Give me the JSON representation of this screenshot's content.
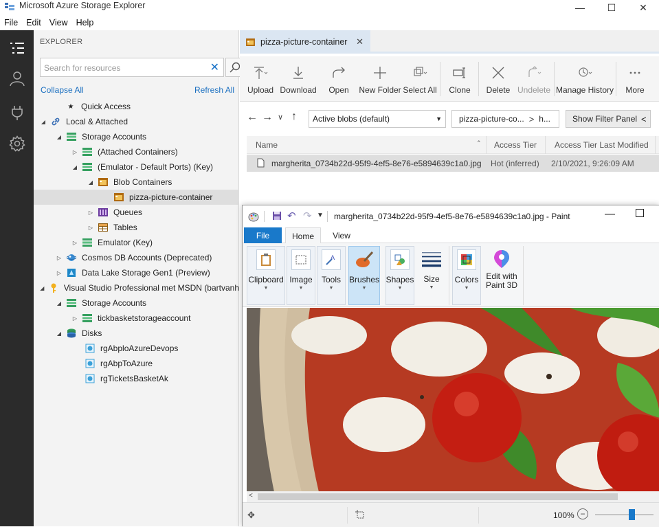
{
  "window": {
    "title": "Microsoft Azure Storage Explorer",
    "icon": "storage-explorer-icon"
  },
  "menu": [
    "File",
    "Edit",
    "View",
    "Help"
  ],
  "activity_bar": [
    "explorer-icon",
    "account-icon",
    "plug-icon",
    "settings-icon"
  ],
  "explorer": {
    "header": "EXPLORER",
    "search_placeholder": "Search for resources",
    "collapse_all": "Collapse All",
    "refresh_all": "Refresh All",
    "tree": [
      "Quick Access",
      "Local & Attached",
      "Storage Accounts",
      "(Attached Containers)",
      "(Emulator - Default Ports) (Key)",
      "Blob Containers",
      "pizza-picture-container",
      "Queues",
      "Tables",
      "Emulator (Key)",
      "Cosmos DB Accounts (Deprecated)",
      "Data Lake Storage Gen1 (Preview)",
      "Visual Studio Professional met MSDN (bartvanh",
      "Storage Accounts",
      "tickbasketstorageaccount",
      "Disks",
      "rgAbploAzureDevops",
      "rgAbpToAzure",
      "rgTicketsBasketAk"
    ]
  },
  "tab": {
    "label": "pizza-picture-container"
  },
  "toolbar": [
    "Upload",
    "Download",
    "Open",
    "New Folder",
    "Select All",
    "Clone",
    "Delete",
    "Undelete",
    "Manage History",
    "More"
  ],
  "nav": {
    "view_select": "Active blobs (default)",
    "path1": "pizza-picture-co...",
    "path2": "h...",
    "filter_button": "Show Filter Panel"
  },
  "grid": {
    "columns": [
      "Name",
      "Access Tier",
      "Access Tier Last Modified"
    ],
    "rows": [
      {
        "name": "margherita_0734b22d-95f9-4ef5-8e76-e5894639c1a0.jpg",
        "tier": "Hot (inferred)",
        "modified": "2/10/2021, 9:26:09 AM"
      }
    ]
  },
  "paint": {
    "title": "margherita_0734b22d-95f9-4ef5-8e76-e5894639c1a0.jpg - Paint",
    "tabs": [
      "File",
      "Home",
      "View"
    ],
    "groups": [
      "Clipboard",
      "Image",
      "Tools",
      "Brushes",
      "Shapes",
      "Size",
      "Colors",
      "Edit with",
      "Paint 3D"
    ],
    "zoom": "100%",
    "zoom_fraction": 0.62
  },
  "colors": {
    "accent": "#0078d7",
    "activity_bg": "#2b2b2b",
    "selection": "#dedede",
    "link": "#1a6fc0"
  }
}
